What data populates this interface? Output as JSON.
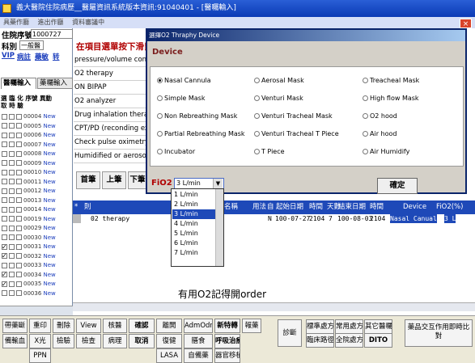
{
  "window": {
    "title": "義大醫院住院病歷__醫屬資訊系統版本資訊:91040401 - [醫囑輸入]",
    "menu": [
      "具藥作廳",
      "進出作廳",
      "資料審議中"
    ],
    "close": "×"
  },
  "patient": {
    "admission_label": "住院序號",
    "admission_value": "1000727",
    "dept_label": "科別",
    "dept_value": "一般醫",
    "vip": "VIP",
    "tag_infect": "病註",
    "tag_drug": "藥敏",
    "tag_extra": "转"
  },
  "tabs": [
    "醫囑輸入",
    "藥囑輸入"
  ],
  "order_list_header": {
    "cols": "選 臨 化 序號 異動",
    "sub": "取 時 驗"
  },
  "orders": [
    {
      "id": "00004",
      "status": "New",
      "checked": false
    },
    {
      "id": "00005",
      "status": "New",
      "checked": false
    },
    {
      "id": "00006",
      "status": "New",
      "checked": false
    },
    {
      "id": "00007",
      "status": "New",
      "checked": false
    },
    {
      "id": "00008",
      "status": "New",
      "checked": false
    },
    {
      "id": "00009",
      "status": "New",
      "checked": false
    },
    {
      "id": "00010",
      "status": "New",
      "checked": false
    },
    {
      "id": "00011",
      "status": "New",
      "checked": false
    },
    {
      "id": "00012",
      "status": "New",
      "checked": false
    },
    {
      "id": "00013",
      "status": "New",
      "checked": false
    },
    {
      "id": "00014",
      "status": "New",
      "checked": false
    },
    {
      "id": "00019",
      "status": "New",
      "checked": false
    },
    {
      "id": "00029",
      "status": "New",
      "checked": false
    },
    {
      "id": "00030",
      "status": "New",
      "checked": false
    },
    {
      "id": "00031",
      "status": "New",
      "checked": true
    },
    {
      "id": "00032",
      "status": "New",
      "checked": true
    },
    {
      "id": "00033",
      "status": "New",
      "checked": false
    },
    {
      "id": "00034",
      "status": "New",
      "checked": true
    },
    {
      "id": "00035",
      "status": "New",
      "checked": true
    },
    {
      "id": "00036",
      "status": "New",
      "checked": false
    }
  ],
  "center": {
    "title": "在項目選單按下滑鼠",
    "items": [
      "pressure/volume control",
      "O2 therapy",
      "ON BIPAP",
      "O2 analyzer",
      "Drug inhalation therapy",
      "CPT/PD (reconding ex",
      "Check pulse oximetry",
      "Humidified or aerosol"
    ]
  },
  "nav": {
    "first": "首筆",
    "prev": "上筆",
    "next": "下筆"
  },
  "table": {
    "headers": [
      "*",
      "則",
      "醫囑名稱",
      "用法",
      "自",
      "起始日期",
      "時間",
      "天數",
      "結束日期",
      "時間",
      "Device",
      "FiO2(%)"
    ],
    "row": {
      "name": "02 therapy",
      "flag": "N",
      "start_date": "100-07-27",
      "start_time": "2104",
      "days": "7",
      "end_date": "100-08-03",
      "end_time": "2104",
      "device": "Nasal Canual",
      "fio2": "3 L"
    }
  },
  "annotation": "有用O2記得開order",
  "bottom_buttons": {
    "row1": [
      "帶藥斷",
      "重印",
      "刪除",
      "View",
      "核醫",
      "確認",
      "離開",
      "AdmOdr",
      "新特轉",
      "報藥"
    ],
    "row2": [
      "備輸血",
      "X光",
      "檢驗",
      "檢查",
      "病理",
      "取消",
      "復健",
      "膳食",
      "呼吸治療"
    ],
    "row3": [
      "PPN",
      "LASA",
      "自備藥",
      "器官移植"
    ],
    "right_col": "診斷",
    "right_grid": [
      "標準處方",
      "常用處方",
      "其它醫囑",
      "臨床路徑",
      "全院處方",
      "DITO"
    ],
    "right_end": "藥品交互作用即時比對"
  },
  "dialog": {
    "title": "選擇O2 Thraphy Device",
    "heading": "Device",
    "options": [
      {
        "label": "Nasal Cannula",
        "selected": true
      },
      {
        "label": "Aerosal Mask",
        "selected": false
      },
      {
        "label": "Treacheal Mask",
        "selected": false
      },
      {
        "label": "Simple Mask",
        "selected": false
      },
      {
        "label": "Venturi Mask",
        "selected": false
      },
      {
        "label": "High flow Mask",
        "selected": false
      },
      {
        "label": "Non Rebreathing Mask",
        "selected": false
      },
      {
        "label": "Venturi Tracheal Mask",
        "selected": false
      },
      {
        "label": "O2 hood",
        "selected": false
      },
      {
        "label": "Partial Rebreathing Mask",
        "selected": false
      },
      {
        "label": "Venturi Tracheal T Piece",
        "selected": false
      },
      {
        "label": "Air hood",
        "selected": false
      },
      {
        "label": "Incubator",
        "selected": false
      },
      {
        "label": "T Piece",
        "selected": false
      },
      {
        "label": "Air Humidify",
        "selected": false
      }
    ],
    "fio2_label": "FiO2",
    "fio2_value": "3 L/min",
    "fio2_options": [
      "1 L/min",
      "2 L/min",
      "3 L/min",
      "4 L/min",
      "5 L/min",
      "6 L/min",
      "7 L/min"
    ],
    "fio2_selected_index": 2,
    "confirm": "確定"
  }
}
